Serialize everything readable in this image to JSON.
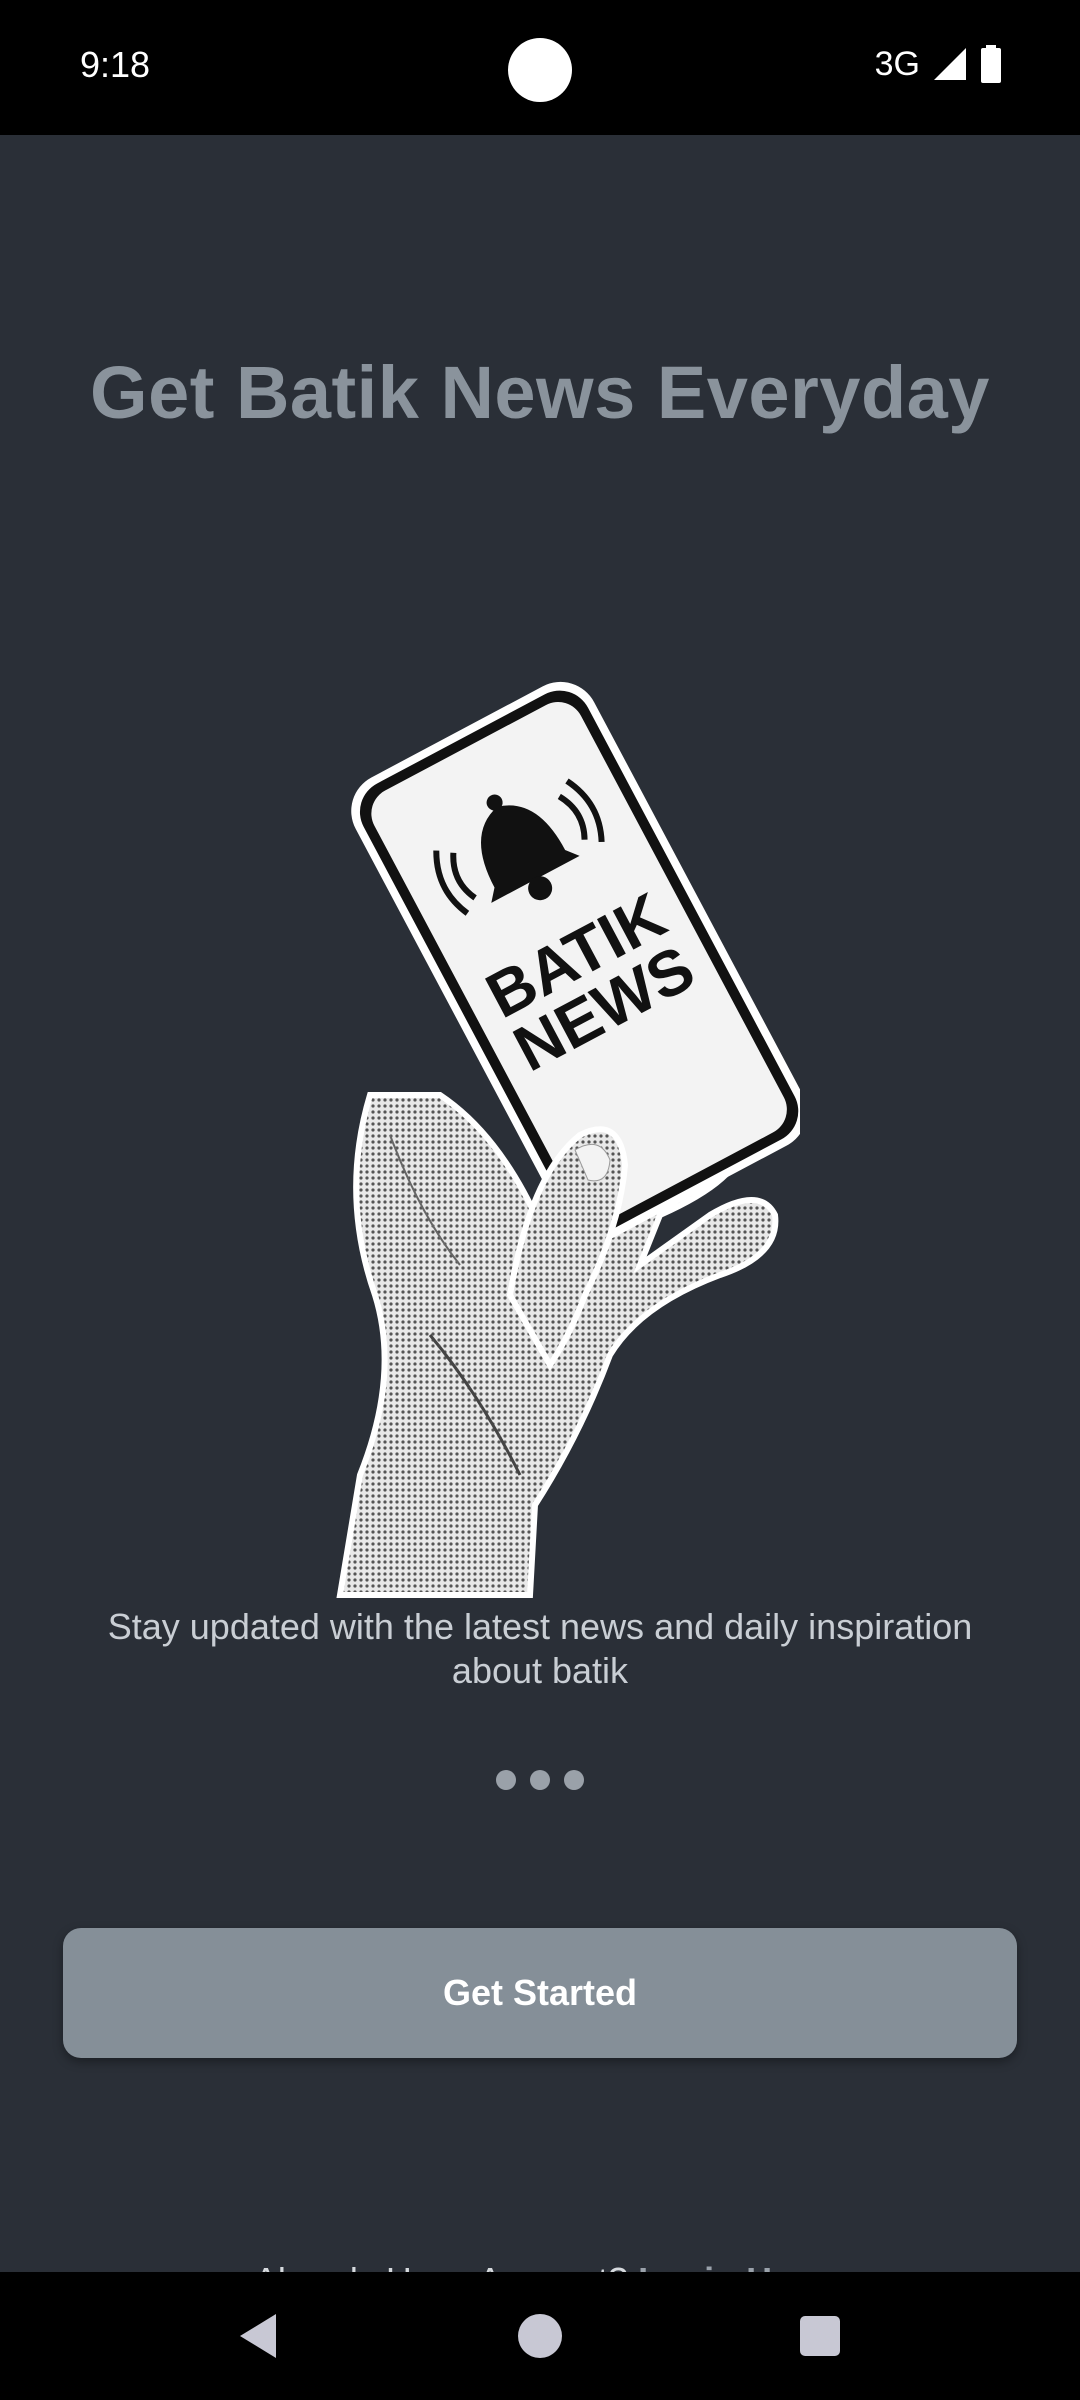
{
  "status_bar": {
    "time": "9:18",
    "network": "3G",
    "icons": [
      "signal-icon",
      "battery-icon"
    ]
  },
  "onboarding": {
    "title": "Get Batik News Everyday",
    "illustration_text": [
      "BATIK",
      "NEWS"
    ],
    "subtitle": "Stay updated with the latest news and daily inspiration about batik",
    "page_indicator": {
      "count": 3,
      "active": 1
    },
    "cta_label": "Get Started",
    "login_prompt": "Already Have Account?",
    "login_link": "Login Here"
  },
  "nav_bar": {
    "icons": [
      "back-icon",
      "home-icon",
      "recents-icon"
    ]
  },
  "colors": {
    "background": "#2a2f37",
    "title": "#8a939c",
    "button": "#858f98",
    "link": "#9aa2ab"
  }
}
